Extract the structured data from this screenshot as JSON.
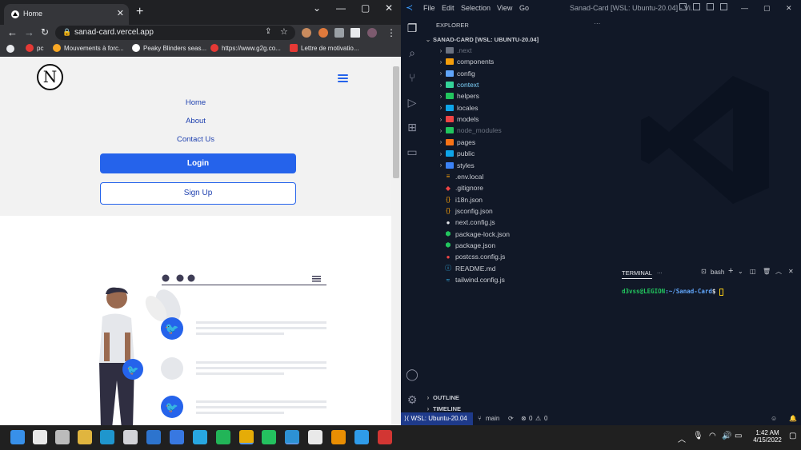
{
  "browser": {
    "tab_title": "Home",
    "url": "sanad-card.vercel.app",
    "bookmarks": [
      {
        "label": "pc",
        "color": "#e53935"
      },
      {
        "label": "Mouvements à forc...",
        "color": "#f9a825"
      },
      {
        "label": "Peaky Blinders seas...",
        "color": "#ffffff"
      },
      {
        "label": "https://www.g2g.co...",
        "color": "#e53935"
      },
      {
        "label": "Lettre de motivatio...",
        "color": "#e53935"
      }
    ]
  },
  "site": {
    "logo_letter": "N",
    "nav_links": [
      "Home",
      "About",
      "Contact Us"
    ],
    "login_label": "Login",
    "signup_label": "Sign Up",
    "accent": "#2563eb"
  },
  "vscode": {
    "menu": [
      "File",
      "Edit",
      "Selection",
      "View",
      "Go"
    ],
    "window_title": "Sanad-Card [WSL: Ubuntu-20.04] - Vi...",
    "explorer_title": "EXPLORER",
    "workspace": "SANAD-CARD [WSL: UBUNTU-20.04]",
    "tree": [
      {
        "name": ".next",
        "type": "folder",
        "color": "#6b7280",
        "text": "#6b7280"
      },
      {
        "name": "components",
        "type": "folder",
        "color": "#f59e0b",
        "text": "#c9ccd3"
      },
      {
        "name": "config",
        "type": "folder",
        "color": "#60a5fa",
        "text": "#c9ccd3"
      },
      {
        "name": "context",
        "type": "folder",
        "color": "#34d399",
        "text": "#7dd3fc"
      },
      {
        "name": "helpers",
        "type": "folder",
        "color": "#22c55e",
        "text": "#c9ccd3"
      },
      {
        "name": "locales",
        "type": "folder",
        "color": "#0ea5e9",
        "text": "#c9ccd3"
      },
      {
        "name": "models",
        "type": "folder",
        "color": "#ef4444",
        "text": "#c9ccd3"
      },
      {
        "name": "node_modules",
        "type": "folder",
        "color": "#22c55e",
        "text": "#6b7280"
      },
      {
        "name": "pages",
        "type": "folder",
        "color": "#f97316",
        "text": "#c9ccd3"
      },
      {
        "name": "public",
        "type": "folder",
        "color": "#0ea5e9",
        "text": "#c9ccd3"
      },
      {
        "name": "styles",
        "type": "folder",
        "color": "#3b82f6",
        "text": "#c9ccd3"
      },
      {
        "name": ".env.local",
        "type": "file",
        "icon": "≡",
        "color": "#f59e0b",
        "text": "#c9ccd3"
      },
      {
        "name": ".gitignore",
        "type": "file",
        "icon": "◆",
        "color": "#ef4444",
        "text": "#c9ccd3"
      },
      {
        "name": "i18n.json",
        "type": "file",
        "icon": "{}",
        "color": "#f59e0b",
        "text": "#c9ccd3"
      },
      {
        "name": "jsconfig.json",
        "type": "file",
        "icon": "{}",
        "color": "#f59e0b",
        "text": "#c9ccd3"
      },
      {
        "name": "next.config.js",
        "type": "file",
        "icon": "●",
        "color": "#e5e7eb",
        "text": "#c9ccd3"
      },
      {
        "name": "package-lock.json",
        "type": "file",
        "icon": "⬢",
        "color": "#22c55e",
        "text": "#c9ccd3"
      },
      {
        "name": "package.json",
        "type": "file",
        "icon": "⬢",
        "color": "#22c55e",
        "text": "#c9ccd3"
      },
      {
        "name": "postcss.config.js",
        "type": "file",
        "icon": "●",
        "color": "#ef4444",
        "text": "#c9ccd3"
      },
      {
        "name": "README.md",
        "type": "file",
        "icon": "ⓘ",
        "color": "#38bdf8",
        "text": "#c9ccd3"
      },
      {
        "name": "tailwind.config.js",
        "type": "file",
        "icon": "≈",
        "color": "#38bdf8",
        "text": "#c9ccd3"
      }
    ],
    "outline": "OUTLINE",
    "timeline": "TIMELINE",
    "terminal_tab": "TERMINAL",
    "terminal_more": "...",
    "shell": "bash",
    "prompt_user": "d3vss@LEGION",
    "prompt_path": ":~/Sanad-Card",
    "prompt_symbol": "$",
    "status_remote": "WSL: Ubuntu-20.04",
    "status_branch": "main",
    "status_errors": "0",
    "status_warnings": "0"
  },
  "taskbar": {
    "time": "1:42 AM",
    "date": "4/15/2022",
    "apps": [
      {
        "name": "windows-start-icon",
        "color": "#3b9cff"
      },
      {
        "name": "search-icon",
        "color": "#ffffff"
      },
      {
        "name": "task-view-icon",
        "color": "#cccccc"
      },
      {
        "name": "file-explorer-icon",
        "color": "#f5c542"
      },
      {
        "name": "edge-icon",
        "color": "#1fa3e0"
      },
      {
        "name": "store-icon",
        "color": "#e5e7eb"
      },
      {
        "name": "mail-icon",
        "color": "#2f7de1"
      },
      {
        "name": "todo-icon",
        "color": "#3b82f6"
      },
      {
        "name": "launcher-icon",
        "color": "#29b6f6"
      },
      {
        "name": "xbox-icon",
        "color": "#22c55e"
      },
      {
        "name": "chrome-icon",
        "color": "#fbbc05"
      },
      {
        "name": "whatsapp-icon",
        "color": "#25d366"
      },
      {
        "name": "vscode-icon",
        "color": "#2f9ee8"
      },
      {
        "name": "app-icon",
        "color": "#ffffff"
      },
      {
        "name": "illustrator-icon",
        "color": "#ff9a00"
      },
      {
        "name": "photoshop-icon",
        "color": "#31a8ff"
      },
      {
        "name": "calendar-icon",
        "color": "#e53935"
      }
    ]
  }
}
